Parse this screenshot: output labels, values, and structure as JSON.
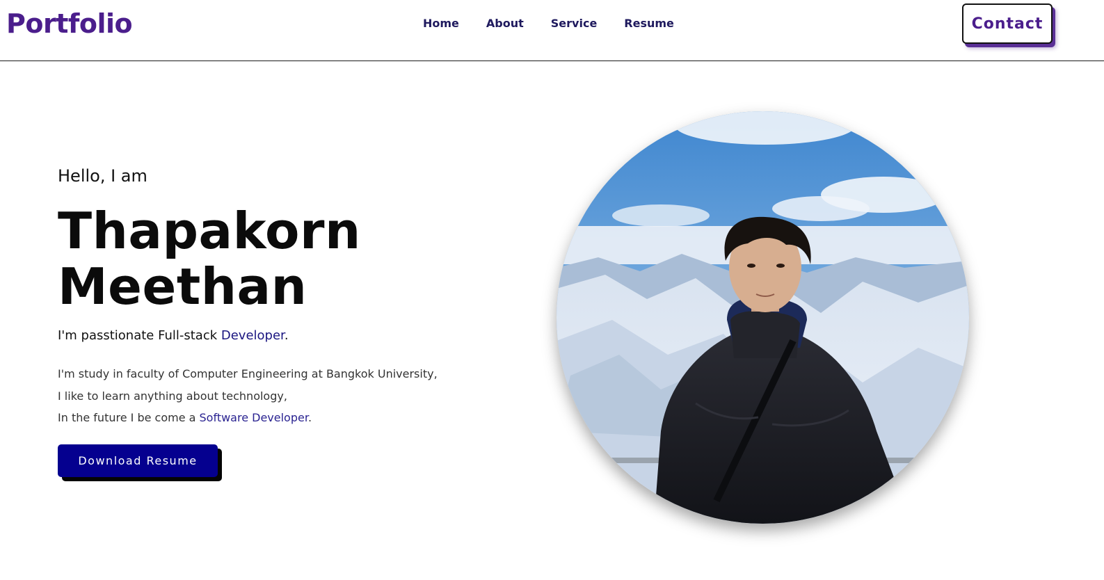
{
  "header": {
    "logo": "Portfolio",
    "nav": [
      {
        "label": "Home"
      },
      {
        "label": "About"
      },
      {
        "label": "Service"
      },
      {
        "label": "Resume"
      }
    ],
    "contact_label": "Contact"
  },
  "hero": {
    "greeting": "Hello, I am",
    "name_first": "Thapakorn",
    "name_last": "Meethan",
    "tagline_prefix": "I'm passtionate Full-stack ",
    "tagline_accent": "Developer",
    "tagline_suffix": ".",
    "bio_line1": "I'm study in faculty of Computer Engineering at Bangkok University,",
    "bio_line2": "I like to learn anything about technology,",
    "bio_line3_prefix": "In the future I be come a ",
    "bio_line3_accent": "Software Developer",
    "bio_line3_suffix": ".",
    "download_label": "Download Resume"
  },
  "colors": {
    "brand": "#4b1e8c",
    "nav_text": "#1f1a5e",
    "accent": "#1a1580",
    "button_bg": "#05008f"
  }
}
